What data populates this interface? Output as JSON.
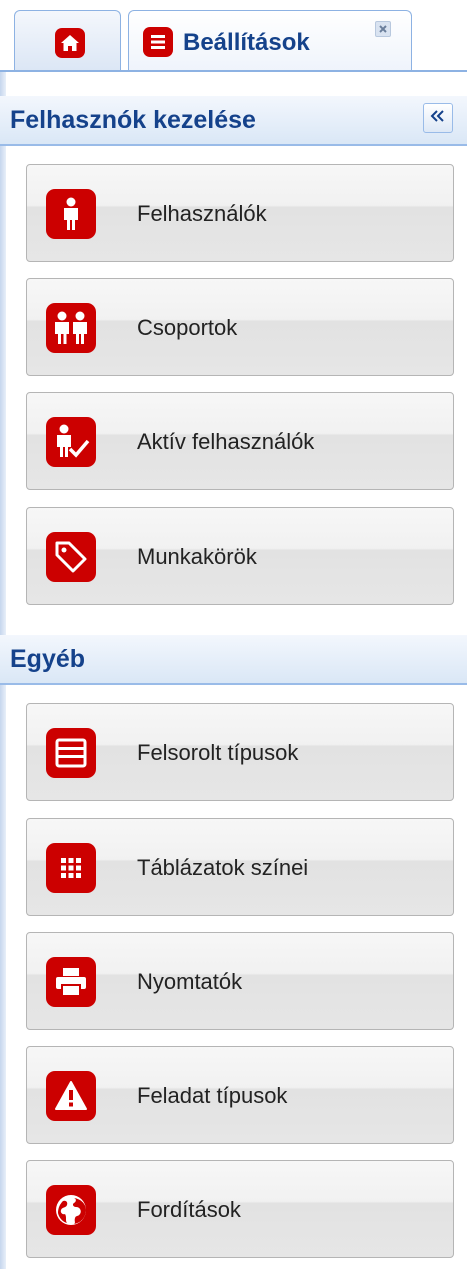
{
  "tabs": {
    "home": {
      "icon": "home-icon"
    },
    "settings": {
      "label": "Beállítások",
      "icon": "list-icon",
      "close_icon": "close-icon"
    }
  },
  "sections": {
    "user_management": {
      "title": "Felhasznók kezelése",
      "collapse_icon": "double-chevron-left-icon",
      "buttons": [
        {
          "label": "Felhasználók",
          "icon": "user-icon"
        },
        {
          "label": "Csoportok",
          "icon": "group-icon"
        },
        {
          "label": "Aktív felhasználók",
          "icon": "active-user-icon"
        },
        {
          "label": "Munkakörök",
          "icon": "tag-icon"
        }
      ]
    },
    "other": {
      "title": "Egyéb",
      "buttons": [
        {
          "label": "Felsorolt típusok",
          "icon": "enum-list-icon"
        },
        {
          "label": "Táblázatok színei",
          "icon": "grid-icon"
        },
        {
          "label": "Nyomtatók",
          "icon": "printer-icon"
        },
        {
          "label": "Feladat típusok",
          "icon": "warning-icon"
        },
        {
          "label": "Fordítások",
          "icon": "globe-icon"
        }
      ]
    }
  },
  "colors": {
    "accent_red": "#cc0000",
    "header_text": "#15428b",
    "border_blue": "#99bbe8"
  }
}
